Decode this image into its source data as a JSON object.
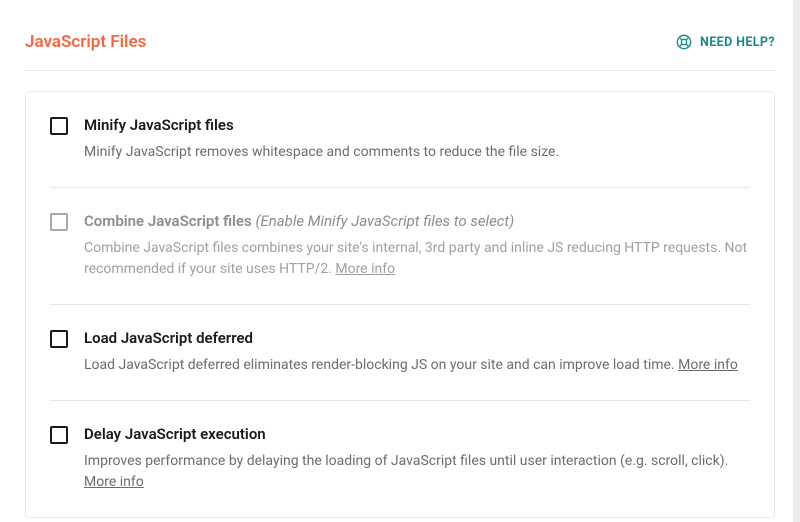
{
  "header": {
    "title": "JavaScript Files",
    "help_label": "NEED HELP?"
  },
  "options": [
    {
      "title": "Minify JavaScript files",
      "hint": "",
      "desc": "Minify JavaScript removes whitespace and comments to reduce the file size.",
      "more_info": "",
      "disabled": false
    },
    {
      "title": "Combine JavaScript files",
      "hint": "(Enable Minify JavaScript files to select)",
      "desc": "Combine JavaScript files combines your site's internal, 3rd party and inline JS reducing HTTP requests. Not recommended if your site uses HTTP/2. ",
      "more_info": "More info",
      "disabled": true
    },
    {
      "title": "Load JavaScript deferred",
      "hint": "",
      "desc": "Load JavaScript deferred eliminates render-blocking JS on your site and can improve load time. ",
      "more_info": "More info",
      "disabled": false
    },
    {
      "title": "Delay JavaScript execution",
      "hint": "",
      "desc": "Improves performance by delaying the loading of JavaScript files until user interaction (e.g. scroll, click). ",
      "more_info": "More info",
      "disabled": false
    }
  ]
}
